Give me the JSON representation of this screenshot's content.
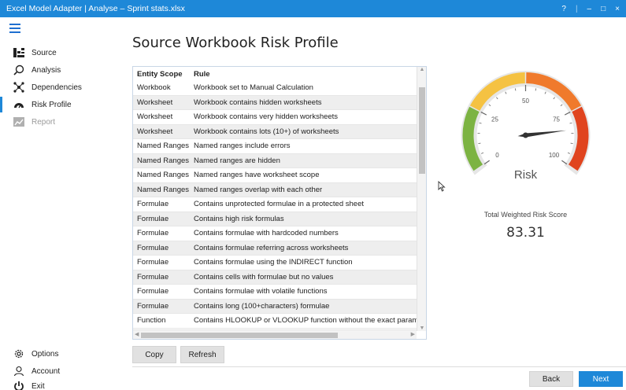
{
  "window": {
    "title": "Excel Model Adapter | Analyse – Sprint stats.xlsx",
    "controls": {
      "help": "?",
      "separator": "|",
      "minimize": "–",
      "maximize": "□",
      "close": "×"
    }
  },
  "sidebar": {
    "items": [
      {
        "label": "Source",
        "icon": "source-icon"
      },
      {
        "label": "Analysis",
        "icon": "search-icon"
      },
      {
        "label": "Dependencies",
        "icon": "dependencies-icon"
      },
      {
        "label": "Risk Profile",
        "icon": "gauge-icon"
      },
      {
        "label": "Report",
        "icon": "report-icon"
      }
    ],
    "bottom": [
      {
        "label": "Options",
        "icon": "gear-icon"
      },
      {
        "label": "Account",
        "icon": "user-icon"
      },
      {
        "label": "Exit",
        "icon": "power-icon"
      }
    ]
  },
  "main": {
    "title": "Source Workbook Risk Profile",
    "table": {
      "headers": [
        "Entity Scope",
        "Rule"
      ],
      "rows": [
        [
          "Workbook",
          "Workbook set to Manual Calculation"
        ],
        [
          "Worksheet",
          "Workbook contains hidden worksheets"
        ],
        [
          "Worksheet",
          "Workbook contains very hidden worksheets"
        ],
        [
          "Worksheet",
          "Workbook contains lots (10+) of worksheets"
        ],
        [
          "Named Ranges",
          "Named ranges include errors"
        ],
        [
          "Named Ranges",
          "Named ranges are hidden"
        ],
        [
          "Named Ranges",
          "Named ranges have worksheet scope"
        ],
        [
          "Named Ranges",
          "Named ranges overlap with each other"
        ],
        [
          "Formulae",
          "Contains unprotected formulae in a protected sheet"
        ],
        [
          "Formulae",
          "Contains high risk formulas"
        ],
        [
          "Formulae",
          "Contains formulae with hardcoded numbers"
        ],
        [
          "Formulae",
          "Contains formulae referring across worksheets"
        ],
        [
          "Formulae",
          "Contains formulae using the INDIRECT function"
        ],
        [
          "Formulae",
          "Contains cells with formulae but no values"
        ],
        [
          "Formulae",
          "Contains formulae with volatile functions"
        ],
        [
          "Formulae",
          "Contains long (100+characters) formulae"
        ],
        [
          "Function",
          "Contains HLOOKUP or VLOOKUP function without the exact parameter"
        ]
      ]
    },
    "buttons": {
      "copy": "Copy",
      "refresh": "Refresh",
      "back": "Back",
      "next": "Next"
    }
  },
  "gauge": {
    "label": "Risk",
    "ticks": [
      "0",
      "25",
      "50",
      "75",
      "100"
    ],
    "min": 0,
    "max": 100,
    "value": 83.31,
    "score_label": "Total Weighted Risk Score",
    "score_value": "83.31",
    "colors": {
      "green": "#7cb342",
      "yellow": "#f5c242",
      "orange": "#f07a2c",
      "red": "#e0441e"
    }
  }
}
